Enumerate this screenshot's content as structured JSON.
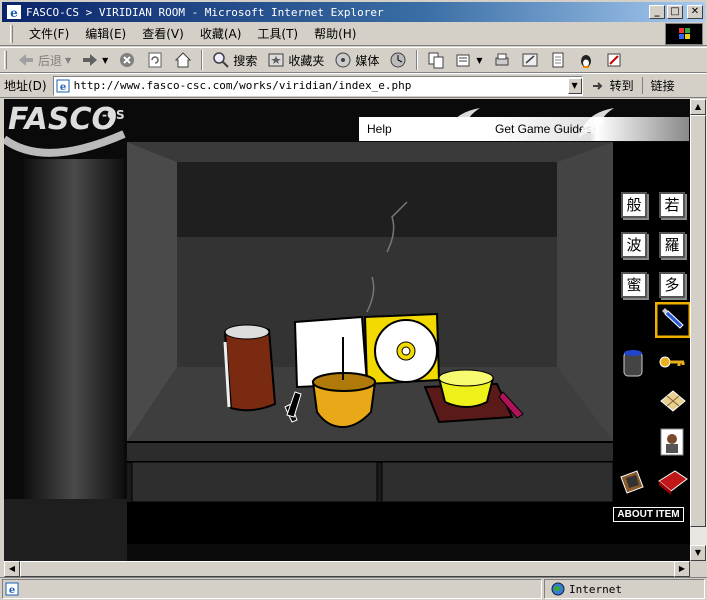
{
  "window": {
    "title": "FASCO-CS > VIRIDIAN ROOM - Microsoft Internet Explorer",
    "buttons": {
      "minimize": "_",
      "maximize": "□",
      "close": "✕"
    }
  },
  "menu": {
    "items": [
      {
        "label": "文件(F)"
      },
      {
        "label": "编辑(E)"
      },
      {
        "label": "查看(V)"
      },
      {
        "label": "收藏(A)"
      },
      {
        "label": "工具(T)"
      },
      {
        "label": "帮助(H)"
      }
    ]
  },
  "toolbar": {
    "back_label": "后退",
    "search_label": "搜索",
    "favorites_label": "收藏夹",
    "media_label": "媒体"
  },
  "address": {
    "label": "地址(D)",
    "url": "http://www.fasco-csc.com/works/viridian/index_e.php",
    "go_label": "转到",
    "links_label": "链接"
  },
  "site": {
    "logo_text": "FASCO-CS",
    "nav_help": "Help",
    "nav_guides": "Get Game Guides"
  },
  "game": {
    "kanji": [
      "般",
      "若",
      "波",
      "羅",
      "蜜",
      "多"
    ],
    "about_label": "ABOUT ITEM",
    "selected_color": "#f0b000"
  },
  "status": {
    "zone": "Internet"
  }
}
